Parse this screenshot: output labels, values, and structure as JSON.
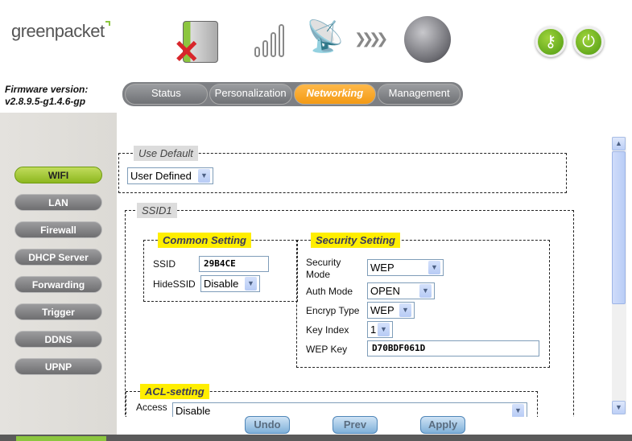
{
  "brand": {
    "logo": "greenpacket"
  },
  "firmware": {
    "label": "Firmware version:",
    "version": "v2.8.9.5-g1.4.6-gp"
  },
  "header_icons": {
    "status": "disconnected-device-icon",
    "signal": "signal-strength-icon",
    "antenna": "satellite-dish-icon",
    "arrows": "chevrons-right-icon",
    "globe": "globe-icon",
    "key": "key-icon",
    "power": "power-icon"
  },
  "tabs": [
    {
      "label": "Status"
    },
    {
      "label": "Personalization"
    },
    {
      "label": "Networking",
      "active": true
    },
    {
      "label": "Management"
    }
  ],
  "sidebar": {
    "items": [
      {
        "label": "WIFI",
        "active": true
      },
      {
        "label": "LAN"
      },
      {
        "label": "Firewall"
      },
      {
        "label": "DHCP Server"
      },
      {
        "label": "Forwarding"
      },
      {
        "label": "Trigger"
      },
      {
        "label": "DDNS"
      },
      {
        "label": "UPNP"
      }
    ]
  },
  "use_default": {
    "legend": "Use Default",
    "value": "User Defined"
  },
  "ssid1": {
    "legend": "SSID1",
    "common": {
      "legend": "Common Setting",
      "ssid_label": "SSID",
      "ssid_value": "29B4CE",
      "hide_label": "HideSSID",
      "hide_value": "Disable"
    },
    "security": {
      "legend": "Security Setting",
      "mode_label": "Security Mode",
      "mode_value": "WEP",
      "auth_label": "Auth Mode",
      "auth_value": "OPEN",
      "enc_label": "Encryp Type",
      "enc_value": "WEP",
      "keyidx_label": "Key Index",
      "keyidx_value": "1",
      "wepkey_label": "WEP Key",
      "wepkey_value": "D70BDF061D"
    }
  },
  "acl": {
    "legend": "ACL-setting",
    "access_label": "Access",
    "access_value": "Disable"
  },
  "buttons": {
    "undo": "Undo",
    "prev": "Prev",
    "apply": "Apply"
  },
  "colors": {
    "accent_green": "#8db71f",
    "active_tab": "#f39a14",
    "legend_yellow": "#ffee00"
  }
}
